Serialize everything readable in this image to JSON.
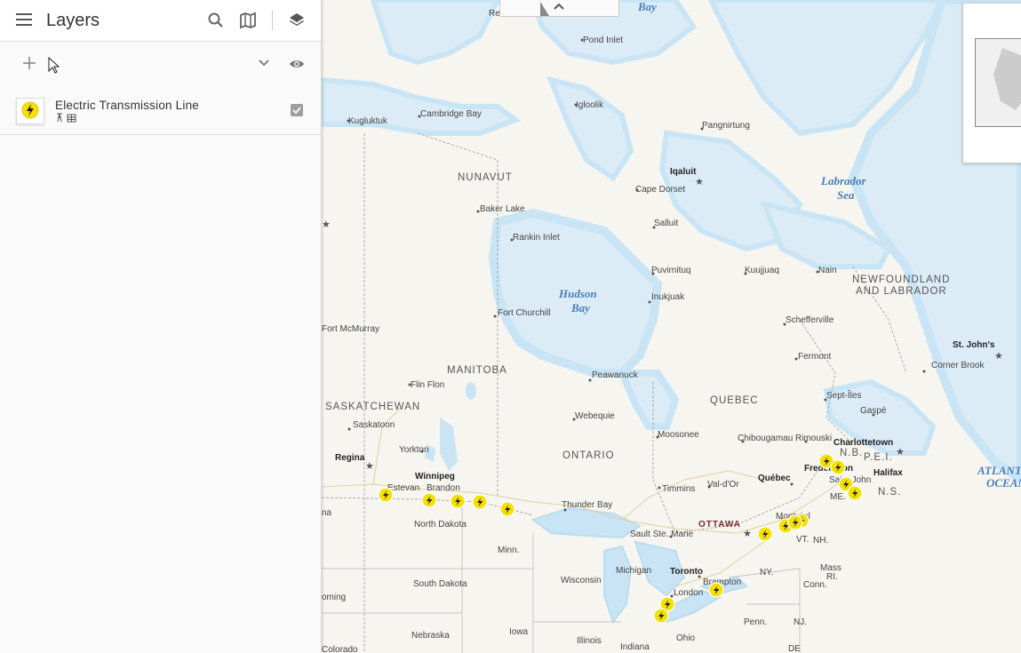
{
  "panel": {
    "title": "Layers",
    "layer": {
      "name": "Electric Transmission Line"
    }
  },
  "map": {
    "labels": {
      "resolute": "Resolute",
      "bay_top": "Bay",
      "pond_inlet": "Pond Inlet",
      "kugluktuk": "Kugluktuk",
      "cambridge_bay": "Cambridge Bay",
      "igloolik": "Igloolik",
      "pangnirtung": "Pangnirtung",
      "nunavut": "NUNAVUT",
      "iqaluit": "Iqaluit",
      "cape_dorset": "Cape Dorset",
      "labrador_sea_1": "Labrador",
      "labrador_sea_2": "Sea",
      "baker_lake": "Baker Lake",
      "salluit": "Salluit",
      "rankin_inlet": "Rankin Inlet",
      "puvirnituq": "Puvirnituq",
      "kuujjuaq": "Kuujjuaq",
      "nain": "Nain",
      "nl_1": "NEWFOUNDLAND",
      "nl_2": "AND LABRADOR",
      "hudson_1": "Hudson",
      "hudson_2": "Bay",
      "inukjuak": "Inukjuak",
      "fort_churchill": "Fort Churchill",
      "schefferville": "Schefferville",
      "fort_mcmurray": "Fort McMurray",
      "st_johns": "St. John's",
      "fermont": "Fermont",
      "corner_brook": "Corner Brook",
      "manitoba": "MANITOBA",
      "peawanuck": "Peawanuck",
      "flin_flon": "Flin Flon",
      "quebec_prov": "QUEBEC",
      "sept_iles": "Sept-Îles",
      "saskatchewan": "SASKATCHEWAN",
      "gaspe": "Gaspé",
      "webequie": "Webequie",
      "saskatoon": "Saskatoon",
      "moosonee": "Moosonee",
      "chibougamau": "Chibougamau",
      "rimouski": "Rimouski",
      "charlottetown": "Charlottetown",
      "yorkton": "Yorkton",
      "nb": "N.B.",
      "pei": "P.E.I.",
      "ontario": "ONTARIO",
      "regina": "Regina",
      "fredericton": "Fredericton",
      "atlantic_1": "ATLANTIC",
      "atlantic_2": "OCEAN",
      "winnipeg": "Winnipeg",
      "quebec_city": "Québec",
      "halifax": "Halifax",
      "saint_john": "Saint John",
      "estevan": "Estevan",
      "brandon": "Brandon",
      "timmins": "Timmins",
      "val_dor": "Val-d'Or",
      "ns": "N.S.",
      "me": "ME.",
      "thunder_bay": "Thunder Bay",
      "north_dakota": "North Dakota",
      "ottawa": "OTTAWA",
      "montreal": "Montréal",
      "sault": "Sault Ste. Marie",
      "vt": "VT.",
      "nh": "NH.",
      "minn": "Minn.",
      "michigan": "Michigan",
      "toronto": "Toronto",
      "ny": "NY.",
      "mass": "Mass",
      "ri": "RI.",
      "wisconsin": "Wisconsin",
      "south_dakota": "South Dakota",
      "london": "London",
      "hampton": "Brampton",
      "conn": "Conn.",
      "oming": "oming",
      "penn": "Penn.",
      "nj": "NJ.",
      "nebraska": "Nebraska",
      "iowa": "Iowa",
      "ohio": "Ohio",
      "illinois": "Illinois",
      "indiana": "Indiana",
      "de": "DE",
      "colorado": "Colorado",
      "na": "na"
    }
  },
  "colors": {
    "marker_fill": "#f5e000",
    "water_light": "#c9e5f5",
    "water_mid": "#dcecf6",
    "land": "#f6f5f0"
  },
  "icons": {
    "menu": "menu-icon",
    "search": "search-icon",
    "basemap": "map-icon",
    "layers": "layers-icon",
    "add": "add-icon",
    "chevron": "chevron-down-icon",
    "visibility": "eye-icon",
    "checkbox": "checkbox-icon",
    "lightning": "lightning-icon"
  }
}
